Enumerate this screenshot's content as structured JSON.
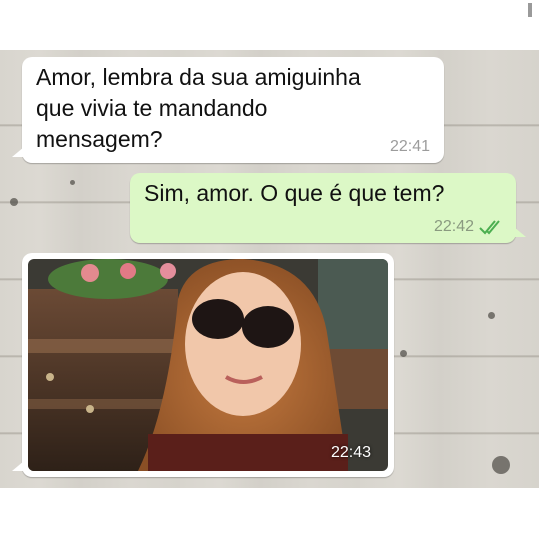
{
  "messages": [
    {
      "direction": "incoming",
      "text_lines": [
        "Amor, lembra da sua amiguinha",
        "que vivia te mandando",
        "mensagem?"
      ],
      "time": "22:41"
    },
    {
      "direction": "outgoing",
      "text_lines": [
        "Sim, amor. O que é que tem?"
      ],
      "time": "22:42",
      "read_receipt": "double-check-icon",
      "read_color": "#4fc3f7"
    },
    {
      "direction": "incoming",
      "type": "image",
      "image": "selfie-with-sunglasses-near-casket",
      "time": "22:43"
    }
  ],
  "colors": {
    "incoming_bubble": "#ffffff",
    "outgoing_bubble": "#dcf8c6",
    "wallpaper": "#d8d5ce",
    "timestamp": "#9c9c9c"
  }
}
